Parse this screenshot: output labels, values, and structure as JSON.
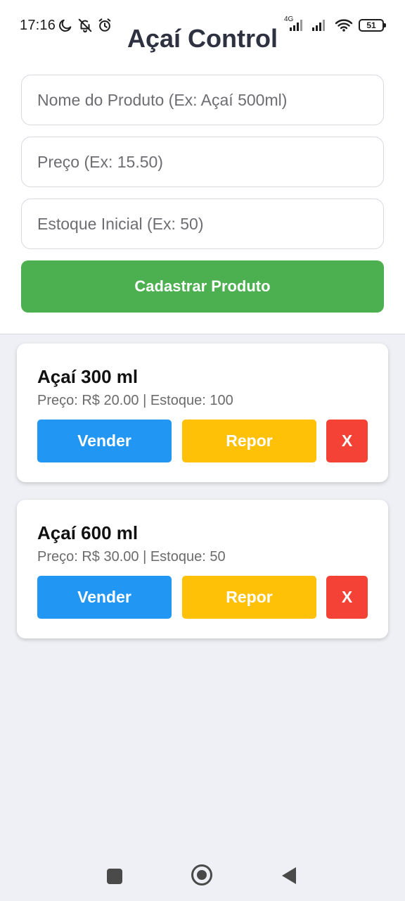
{
  "status_bar": {
    "time": "17:16",
    "network": "4G",
    "battery": "51"
  },
  "app": {
    "title": "Açaí Control"
  },
  "form": {
    "name_placeholder": "Nome do Produto (Ex: Açaí 500ml)",
    "price_placeholder": "Preço (Ex: 15.50)",
    "stock_placeholder": "Estoque Inicial (Ex: 50)",
    "submit_label": "Cadastrar Produto"
  },
  "products": [
    {
      "name": "Açaí 300 ml",
      "info": "Preço: R$ 20.00 | Estoque: 100",
      "sell_label": "Vender",
      "restock_label": "Repor",
      "delete_label": "X"
    },
    {
      "name": "Açaí 600 ml",
      "info": "Preço: R$ 30.00 | Estoque: 50",
      "sell_label": "Vender",
      "restock_label": "Repor",
      "delete_label": "X"
    }
  ],
  "colors": {
    "submit": "#4caf50",
    "sell": "#2196f3",
    "restock": "#ffc107",
    "delete": "#f44336",
    "background": "#eef0f5"
  },
  "icons": {
    "status_left": [
      "moon-icon",
      "bell-off-icon",
      "alarm-icon"
    ],
    "status_right": [
      "signal-icon",
      "signal-icon",
      "wifi-icon",
      "battery-icon"
    ],
    "nav": [
      "recents-square-icon",
      "home-circle-icon",
      "back-triangle-icon"
    ]
  }
}
